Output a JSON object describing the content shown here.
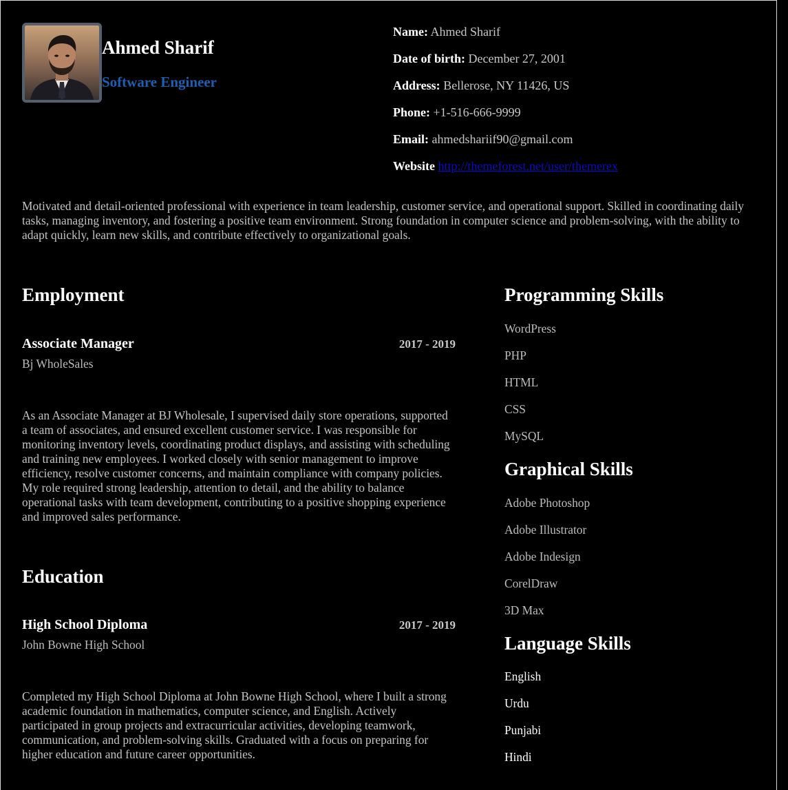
{
  "profile": {
    "name": "Ahmed Sharif",
    "title": "Software Engineer",
    "avatar_icon": "person-portrait-icon"
  },
  "contact": {
    "name_label": "Name:",
    "name_value": "Ahmed Sharif",
    "dob_label": "Date of birth:",
    "dob_value": "December 27, 2001",
    "address_label": "Address:",
    "address_value": "Bellerose, NY 11426, US",
    "phone_label": "Phone:",
    "phone_value": "+1-516-666-9999",
    "email_label": "Email:",
    "email_value": "ahmedshariif90@gmail.com",
    "website_label": "Website",
    "website_value": "http://themeforest.net/user/themerex"
  },
  "summary": "Motivated and detail-oriented professional with experience in team leadership, customer service, and operational support. Skilled in coordinating daily tasks, managing inventory, and fostering a positive team environment. Strong foundation in computer science and problem-solving, with the ability to adapt quickly, learn new skills, and contribute effectively to organizational goals.",
  "employment": {
    "heading": "Employment",
    "position": "Associate Manager",
    "years": "2017 - 2019",
    "company": "Bj WholeSales",
    "description": "As an Associate Manager at BJ Wholesale, I supervised daily store operations, supported a team of associates, and ensured excellent customer service. I was responsible for monitoring inventory levels, coordinating product displays, and assisting with scheduling and training new employees. I worked closely with senior management to improve efficiency, resolve customer concerns, and maintain compliance with company policies. My role required strong leadership, attention to detail, and the ability to balance operational tasks with team development, contributing to a positive shopping experience and improved sales performance."
  },
  "education": {
    "heading": "Education",
    "degree": "High School Diploma",
    "years": "2017 - 2019",
    "school": "John Bowne High School",
    "description": "Completed my High School Diploma at John Bowne High School, where I built a strong academic foundation in mathematics, computer science, and English. Actively participated in group projects and extracurricular activities, developing teamwork, communication, and problem-solving skills. Graduated with a focus on preparing for higher education and future career opportunities."
  },
  "programming_skills": {
    "heading": "Programming Skills",
    "items": [
      "WordPress",
      "PHP",
      "HTML",
      "CSS",
      "MySQL"
    ]
  },
  "graphical_skills": {
    "heading": "Graphical Skills",
    "items": [
      "Adobe Photoshop",
      "Adobe Illustrator",
      "Adobe Indesign",
      "CorelDraw",
      "3D Max"
    ]
  },
  "language_skills": {
    "heading": "Language Skills",
    "items": [
      "English",
      "Urdu",
      "Punjabi",
      "Hindi"
    ]
  },
  "colors": {
    "background": "#000000",
    "accent_title": "#1f5fb2",
    "link": "#0b0bc8"
  }
}
